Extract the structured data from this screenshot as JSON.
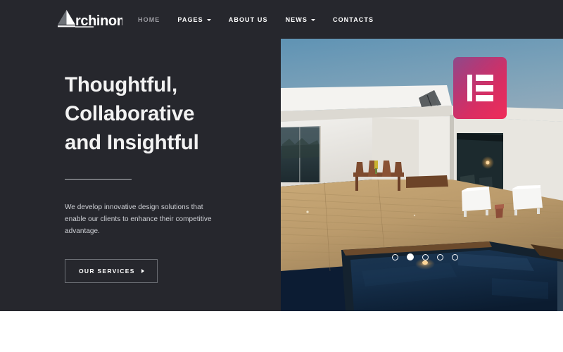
{
  "site": {
    "brand_name": "Archinom",
    "logo_mark": "triangle-a-mark"
  },
  "header": {
    "nav": [
      {
        "label": "HOME",
        "state": "active",
        "has_dropdown": false
      },
      {
        "label": "PAGES",
        "state": "default",
        "has_dropdown": true
      },
      {
        "label": "ABOUT US",
        "state": "default",
        "has_dropdown": false
      },
      {
        "label": "NEWS",
        "state": "default",
        "has_dropdown": true
      },
      {
        "label": "CONTACTS",
        "state": "default",
        "has_dropdown": false
      }
    ]
  },
  "hero": {
    "title": "Thoughtful,\nCollaborative\nand Insightful",
    "description": "We develop innovative design solutions that enable our clients to enhance their competitive advantage.",
    "cta_label": "OUR SERVICES",
    "cta_icon": "chevron-right-icon",
    "background_color": "#26272d",
    "title_color": "#f2f2f2",
    "image_alt": "Modern house with wooden deck and swimming pool at dusk"
  },
  "badge": {
    "name": "elementor-logo",
    "gradient_start": "#8e4a8a",
    "gradient_end": "#ef2c59"
  },
  "carousel": {
    "total_slides": 5,
    "active_slide": 2
  }
}
